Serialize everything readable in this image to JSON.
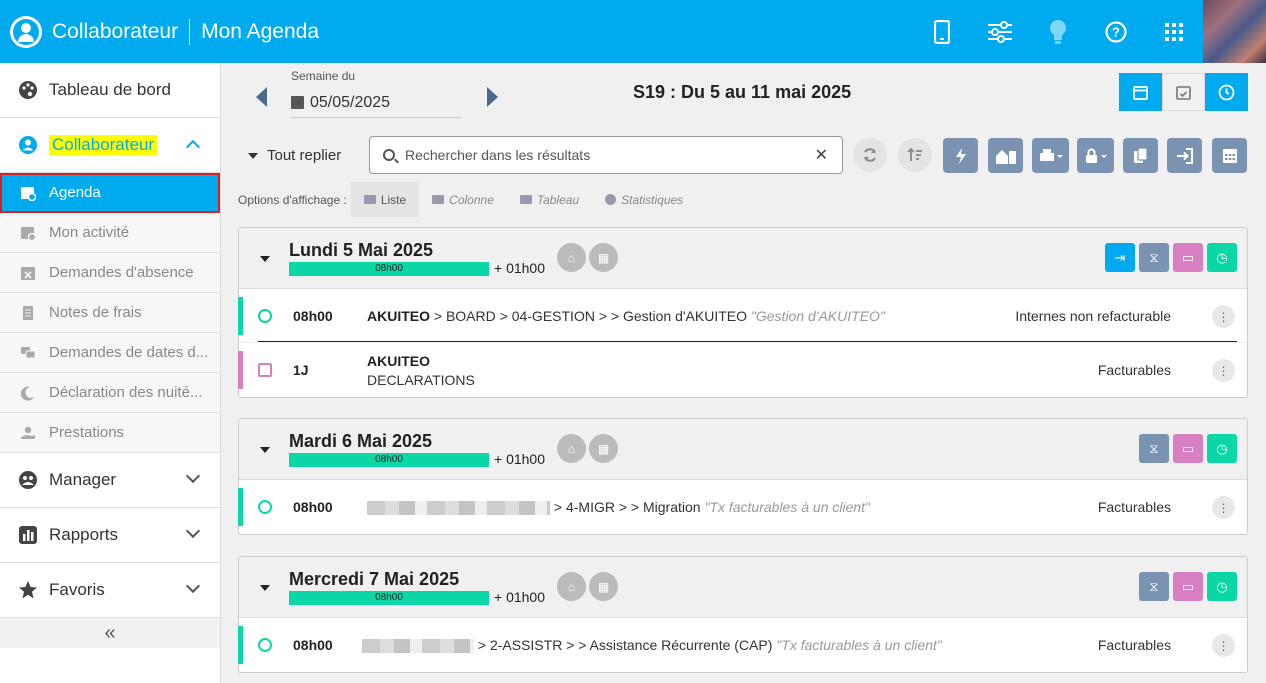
{
  "header": {
    "app_title": "Collaborateur",
    "page_title": "Mon Agenda",
    "icons": [
      "mobile-icon",
      "sliders-icon",
      "lightbulb-icon",
      "help-icon",
      "apps-grid-icon"
    ]
  },
  "sidebar": {
    "dashboard": "Tableau de bord",
    "collaborateur": "Collaborateur",
    "items": [
      {
        "label": "Agenda"
      },
      {
        "label": "Mon activité"
      },
      {
        "label": "Demandes d'absence"
      },
      {
        "label": "Notes de frais"
      },
      {
        "label": "Demandes de dates d..."
      },
      {
        "label": "Déclaration des nuité..."
      },
      {
        "label": "Prestations"
      }
    ],
    "manager": "Manager",
    "rapports": "Rapports",
    "favoris": "Favoris",
    "collapse": "«"
  },
  "week": {
    "label": "Semaine du",
    "date": "05/05/2025",
    "title": "S19 : Du 5 au 11 mai 2025"
  },
  "toolbar": {
    "collapse_all": "Tout replier",
    "search_placeholder": "Rechercher dans les résultats"
  },
  "options": {
    "label": "Options d'affichage :",
    "liste": "Liste",
    "colonne": "Colonne",
    "tableau": "Tableau",
    "statistiques": "Statistiques"
  },
  "days": [
    {
      "name": "Lundi 5 Mai 2025",
      "bar": "08h00",
      "extra": "+ 01h00",
      "rows": [
        {
          "dur": "08h00",
          "bold": "AKUITEO",
          "path": " > BOARD > 04-GESTION > > Gestion d'AKUITEO ",
          "note": "\"Gestion d'AKUITEO\"",
          "cat": "Internes non refacturable"
        },
        {
          "dur": "1J",
          "bold": "AKUITEO",
          "line2": "DECLARATIONS",
          "cat": "Facturables"
        }
      ]
    },
    {
      "name": "Mardi 6 Mai 2025",
      "bar": "08h00",
      "extra": "+ 01h00",
      "rows": [
        {
          "dur": "08h00",
          "path": " > 4-MIGR > > Migration ",
          "note": "\"Tx facturables à un client\"",
          "cat": "Facturables"
        }
      ]
    },
    {
      "name": "Mercredi 7 Mai 2025",
      "bar": "08h00",
      "extra": "+ 01h00",
      "rows": [
        {
          "dur": "08h00",
          "path": " > 2-ASSISTR > > Assistance Récurrente (CAP) ",
          "note": "\"Tx facturables à un client\"",
          "cat": "Facturables"
        }
      ]
    }
  ],
  "colors": {
    "brand": "#00aaee",
    "green": "#0ad6a6",
    "pink": "#d77fc0",
    "slate": "#7b93b3"
  }
}
